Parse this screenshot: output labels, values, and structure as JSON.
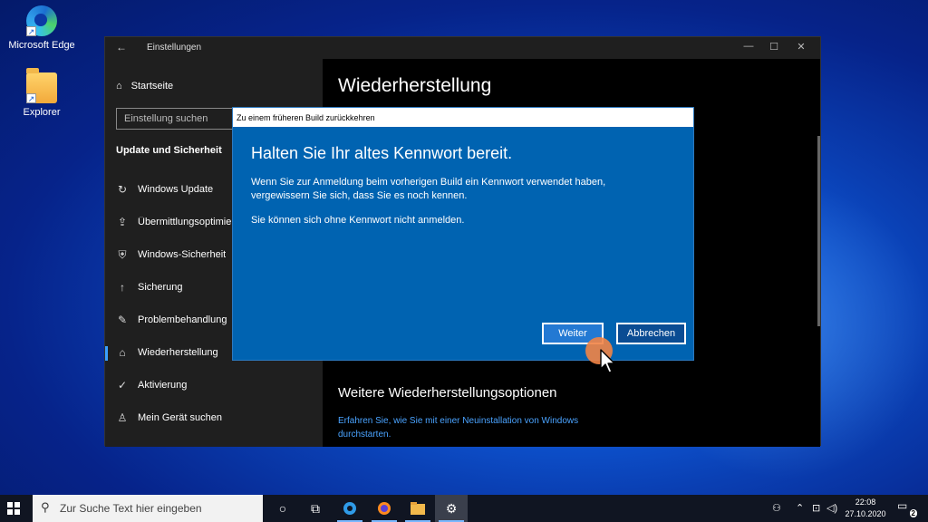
{
  "desktop": {
    "icons": [
      {
        "label": "Microsoft Edge",
        "icon": "edge-icon"
      },
      {
        "label": "Explorer",
        "icon": "folder-icon"
      }
    ]
  },
  "window": {
    "title": "Einstellungen",
    "controls": {
      "minimize": "—",
      "maximize": "☐",
      "close": "✕"
    }
  },
  "sidebar": {
    "home_label": "Startseite",
    "search_placeholder": "Einstellung suchen",
    "section_title": "Update und Sicherheit",
    "items": [
      {
        "label": "Windows Update",
        "icon": "↻"
      },
      {
        "label": "Übermittlungsoptimierung",
        "icon": "⇪"
      },
      {
        "label": "Windows-Sicherheit",
        "icon": "⛨"
      },
      {
        "label": "Sicherung",
        "icon": "↑"
      },
      {
        "label": "Problembehandlung",
        "icon": "✎"
      },
      {
        "label": "Wiederherstellung",
        "icon": "⌂"
      },
      {
        "label": "Aktivierung",
        "icon": "✓"
      },
      {
        "label": "Mein Gerät suchen",
        "icon": "♙"
      }
    ]
  },
  "content": {
    "title": "Wiederherstellung",
    "more_options_title": "Weitere Wiederherstellungsoptionen",
    "link_text": "Erfahren Sie, wie Sie mit einer Neuinstallation von Windows durchstarten."
  },
  "dialog": {
    "title": "Zu einem früheren Build zurückkehren",
    "heading": "Halten Sie Ihr altes Kennwort bereit.",
    "paragraph1": "Wenn Sie zur Anmeldung beim vorherigen Build ein Kennwort verwendet haben, vergewissern Sie sich, dass Sie es noch kennen.",
    "paragraph2": "Sie können sich ohne Kennwort nicht anmelden.",
    "next_label": "Weiter",
    "cancel_label": "Abbrechen"
  },
  "taskbar": {
    "search_placeholder": "Zur Suche Text hier eingeben",
    "clock_time": "22:08",
    "clock_date": "27.10.2020",
    "notification_count": "2"
  },
  "colors": {
    "dialog_bg": "#0063b1",
    "accent": "#3aa0ff",
    "click_indicator": "#f28446"
  }
}
